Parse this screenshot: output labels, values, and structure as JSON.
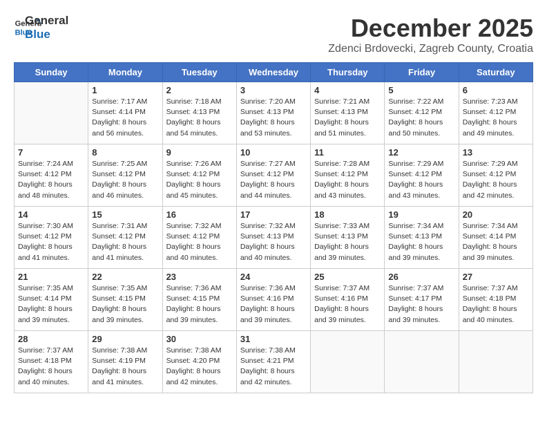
{
  "logo": {
    "line1": "General",
    "line2": "Blue"
  },
  "title": "December 2025",
  "location": "Zdenci Brdovecki, Zagreb County, Croatia",
  "headers": [
    "Sunday",
    "Monday",
    "Tuesday",
    "Wednesday",
    "Thursday",
    "Friday",
    "Saturday"
  ],
  "weeks": [
    [
      {
        "day": "",
        "info": ""
      },
      {
        "day": "1",
        "info": "Sunrise: 7:17 AM\nSunset: 4:14 PM\nDaylight: 8 hours\nand 56 minutes."
      },
      {
        "day": "2",
        "info": "Sunrise: 7:18 AM\nSunset: 4:13 PM\nDaylight: 8 hours\nand 54 minutes."
      },
      {
        "day": "3",
        "info": "Sunrise: 7:20 AM\nSunset: 4:13 PM\nDaylight: 8 hours\nand 53 minutes."
      },
      {
        "day": "4",
        "info": "Sunrise: 7:21 AM\nSunset: 4:13 PM\nDaylight: 8 hours\nand 51 minutes."
      },
      {
        "day": "5",
        "info": "Sunrise: 7:22 AM\nSunset: 4:12 PM\nDaylight: 8 hours\nand 50 minutes."
      },
      {
        "day": "6",
        "info": "Sunrise: 7:23 AM\nSunset: 4:12 PM\nDaylight: 8 hours\nand 49 minutes."
      }
    ],
    [
      {
        "day": "7",
        "info": "Sunrise: 7:24 AM\nSunset: 4:12 PM\nDaylight: 8 hours\nand 48 minutes."
      },
      {
        "day": "8",
        "info": "Sunrise: 7:25 AM\nSunset: 4:12 PM\nDaylight: 8 hours\nand 46 minutes."
      },
      {
        "day": "9",
        "info": "Sunrise: 7:26 AM\nSunset: 4:12 PM\nDaylight: 8 hours\nand 45 minutes."
      },
      {
        "day": "10",
        "info": "Sunrise: 7:27 AM\nSunset: 4:12 PM\nDaylight: 8 hours\nand 44 minutes."
      },
      {
        "day": "11",
        "info": "Sunrise: 7:28 AM\nSunset: 4:12 PM\nDaylight: 8 hours\nand 43 minutes."
      },
      {
        "day": "12",
        "info": "Sunrise: 7:29 AM\nSunset: 4:12 PM\nDaylight: 8 hours\nand 43 minutes."
      },
      {
        "day": "13",
        "info": "Sunrise: 7:29 AM\nSunset: 4:12 PM\nDaylight: 8 hours\nand 42 minutes."
      }
    ],
    [
      {
        "day": "14",
        "info": "Sunrise: 7:30 AM\nSunset: 4:12 PM\nDaylight: 8 hours\nand 41 minutes."
      },
      {
        "day": "15",
        "info": "Sunrise: 7:31 AM\nSunset: 4:12 PM\nDaylight: 8 hours\nand 41 minutes."
      },
      {
        "day": "16",
        "info": "Sunrise: 7:32 AM\nSunset: 4:12 PM\nDaylight: 8 hours\nand 40 minutes."
      },
      {
        "day": "17",
        "info": "Sunrise: 7:32 AM\nSunset: 4:13 PM\nDaylight: 8 hours\nand 40 minutes."
      },
      {
        "day": "18",
        "info": "Sunrise: 7:33 AM\nSunset: 4:13 PM\nDaylight: 8 hours\nand 39 minutes."
      },
      {
        "day": "19",
        "info": "Sunrise: 7:34 AM\nSunset: 4:13 PM\nDaylight: 8 hours\nand 39 minutes."
      },
      {
        "day": "20",
        "info": "Sunrise: 7:34 AM\nSunset: 4:14 PM\nDaylight: 8 hours\nand 39 minutes."
      }
    ],
    [
      {
        "day": "21",
        "info": "Sunrise: 7:35 AM\nSunset: 4:14 PM\nDaylight: 8 hours\nand 39 minutes."
      },
      {
        "day": "22",
        "info": "Sunrise: 7:35 AM\nSunset: 4:15 PM\nDaylight: 8 hours\nand 39 minutes."
      },
      {
        "day": "23",
        "info": "Sunrise: 7:36 AM\nSunset: 4:15 PM\nDaylight: 8 hours\nand 39 minutes."
      },
      {
        "day": "24",
        "info": "Sunrise: 7:36 AM\nSunset: 4:16 PM\nDaylight: 8 hours\nand 39 minutes."
      },
      {
        "day": "25",
        "info": "Sunrise: 7:37 AM\nSunset: 4:16 PM\nDaylight: 8 hours\nand 39 minutes."
      },
      {
        "day": "26",
        "info": "Sunrise: 7:37 AM\nSunset: 4:17 PM\nDaylight: 8 hours\nand 39 minutes."
      },
      {
        "day": "27",
        "info": "Sunrise: 7:37 AM\nSunset: 4:18 PM\nDaylight: 8 hours\nand 40 minutes."
      }
    ],
    [
      {
        "day": "28",
        "info": "Sunrise: 7:37 AM\nSunset: 4:18 PM\nDaylight: 8 hours\nand 40 minutes."
      },
      {
        "day": "29",
        "info": "Sunrise: 7:38 AM\nSunset: 4:19 PM\nDaylight: 8 hours\nand 41 minutes."
      },
      {
        "day": "30",
        "info": "Sunrise: 7:38 AM\nSunset: 4:20 PM\nDaylight: 8 hours\nand 42 minutes."
      },
      {
        "day": "31",
        "info": "Sunrise: 7:38 AM\nSunset: 4:21 PM\nDaylight: 8 hours\nand 42 minutes."
      },
      {
        "day": "",
        "info": ""
      },
      {
        "day": "",
        "info": ""
      },
      {
        "day": "",
        "info": ""
      }
    ]
  ]
}
